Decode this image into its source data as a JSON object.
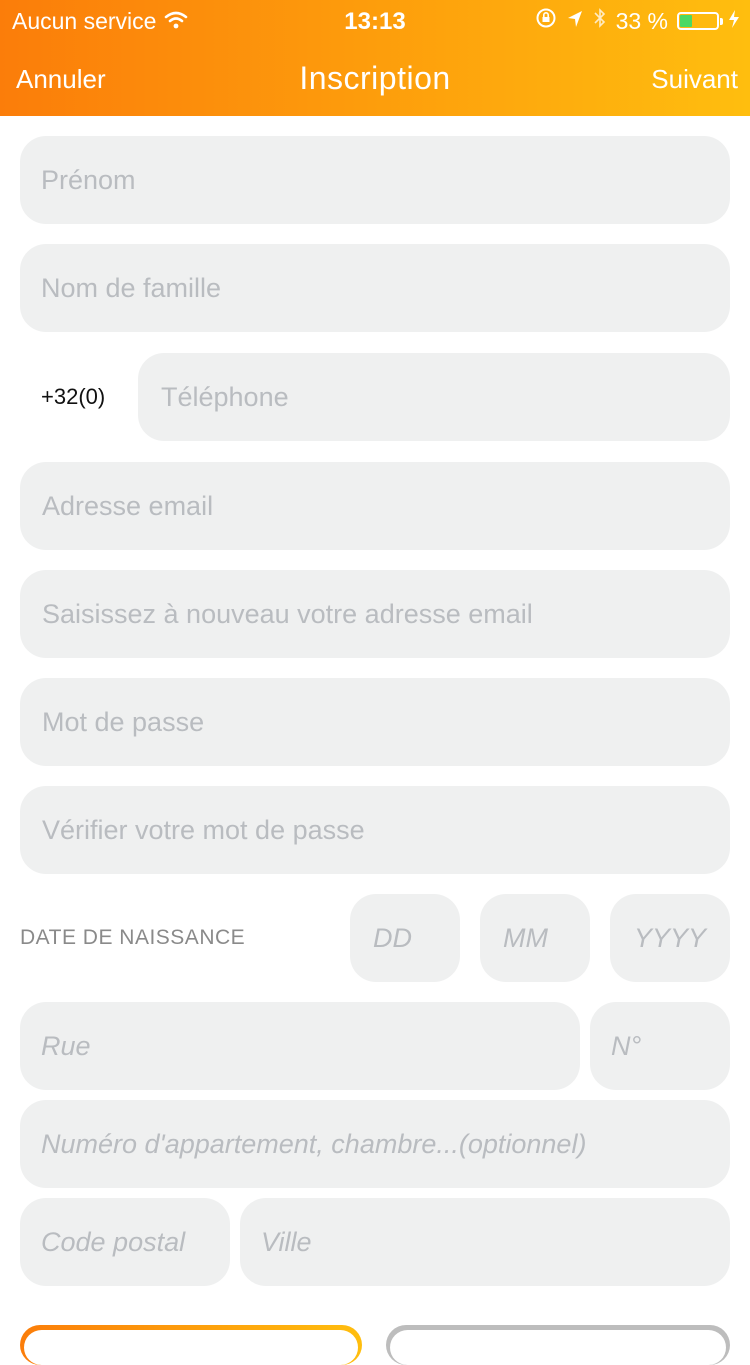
{
  "status_bar": {
    "carrier": "Aucun service",
    "time": "13:13",
    "battery_text": "33 %",
    "battery_level": 0.33
  },
  "nav": {
    "cancel_label": "Annuler",
    "title": "Inscription",
    "next_label": "Suivant"
  },
  "form": {
    "first_name": "Prénom",
    "last_name": "Nom de famille",
    "phone_prefix": "+32(0)",
    "phone": "Téléphone",
    "email": "Adresse email",
    "email_confirm": "Saisissez à nouveau votre adresse email",
    "password": "Mot de passe",
    "password_confirm": "Vérifier votre mot de passe",
    "dob_label": "DATE DE NAISSANCE",
    "dob_day": "DD",
    "dob_month": "MM",
    "dob_year": "YYYY",
    "street": "Rue",
    "number": "N°",
    "apartment": "Numéro d'appartement, chambre...(optionnel)",
    "postal_code": "Code postal",
    "city": "Ville"
  },
  "icons": [
    "wifi-icon",
    "rotation-lock-icon",
    "location-arrow-icon",
    "bluetooth-icon",
    "battery-icon",
    "charging-bolt-icon"
  ]
}
